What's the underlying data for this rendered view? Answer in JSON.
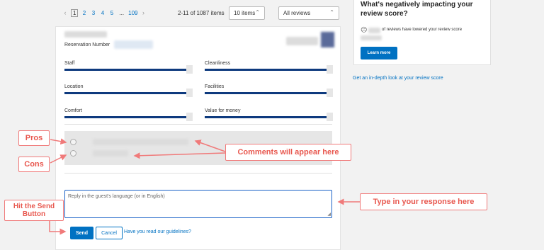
{
  "pagination": {
    "prev_arrow": "‹",
    "pages": [
      "1",
      "2",
      "3",
      "4",
      "5"
    ],
    "ellipsis": "...",
    "last_page": "109",
    "next_arrow": "›",
    "current": "1"
  },
  "count_text": "2-11 of 1087 items",
  "items_select": {
    "value": "10 items"
  },
  "reviews_select": {
    "value": "All reviews"
  },
  "review": {
    "reservation_label": "Reservation Number",
    "scores": [
      {
        "label": "Staff"
      },
      {
        "label": "Cleanliness"
      },
      {
        "label": "Location"
      },
      {
        "label": "Facilities"
      },
      {
        "label": "Comfort"
      },
      {
        "label": "Value for money"
      }
    ],
    "reply_placeholder": "Reply in the guest's language (or in English)",
    "send_label": "Send",
    "cancel_label": "Cancel",
    "guidelines_link": "Have you read our guidelines?"
  },
  "side_panel": {
    "title": "What's negatively impacting your review score?",
    "reviews_text": "of reviews have lowered your review score",
    "learn_more": "Learn more"
  },
  "depth_link": "Get an in-depth look at your review score",
  "annotations": {
    "pros": "Pros",
    "cons": "Cons",
    "comments": "Comments will appear here",
    "type_response": "Type in your response here",
    "hit_send": "Hit the Send Button"
  },
  "colors": {
    "accent": "#0071c2",
    "score_bar": "#0e3a7e",
    "annotation": "#e8584f"
  }
}
